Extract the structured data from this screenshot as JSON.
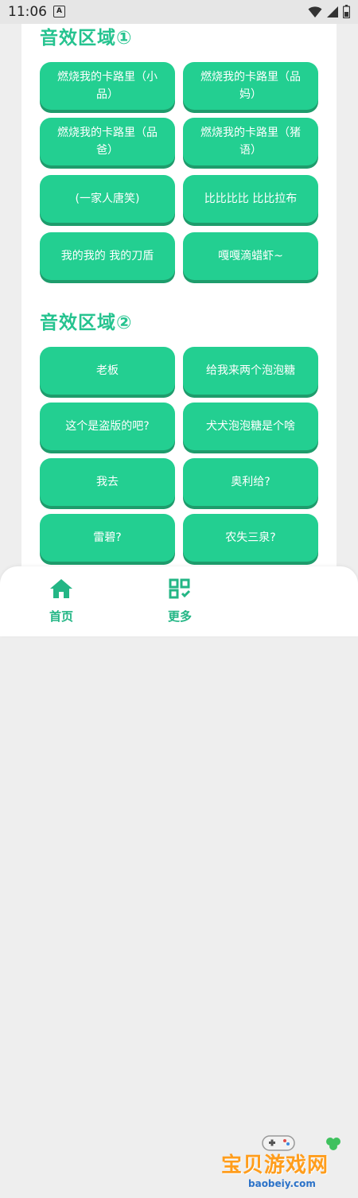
{
  "status_bar": {
    "time": "11:06",
    "notification_icon": "A"
  },
  "sections": [
    {
      "title": "音效区域①",
      "buttons": [
        "燃烧我的卡路里（小品）",
        "燃烧我的卡路里（品妈）",
        "燃烧我的卡路里（品爸）",
        "燃烧我的卡路里（猪语）",
        "(一家人唐笑)",
        "比比比比 比比拉布",
        "我的我的 我的刀盾",
        "嘎嘎滴蜡虾~"
      ]
    },
    {
      "title": "音效区域②",
      "buttons": [
        "老板",
        "给我来两个泡泡糖",
        "这个是盗版的吧?",
        "犬犬泡泡糖是个啥",
        "我去",
        "奥利给?",
        "雷碧?",
        "农失三泉?"
      ]
    }
  ],
  "nav": {
    "home_label": "首页",
    "more_label": "更多"
  },
  "watermark": {
    "text": "宝贝游戏网",
    "url": "baobeiy.com"
  },
  "colors": {
    "accent": "#23cf91",
    "title": "#25c38f",
    "nav": "#23b685"
  }
}
